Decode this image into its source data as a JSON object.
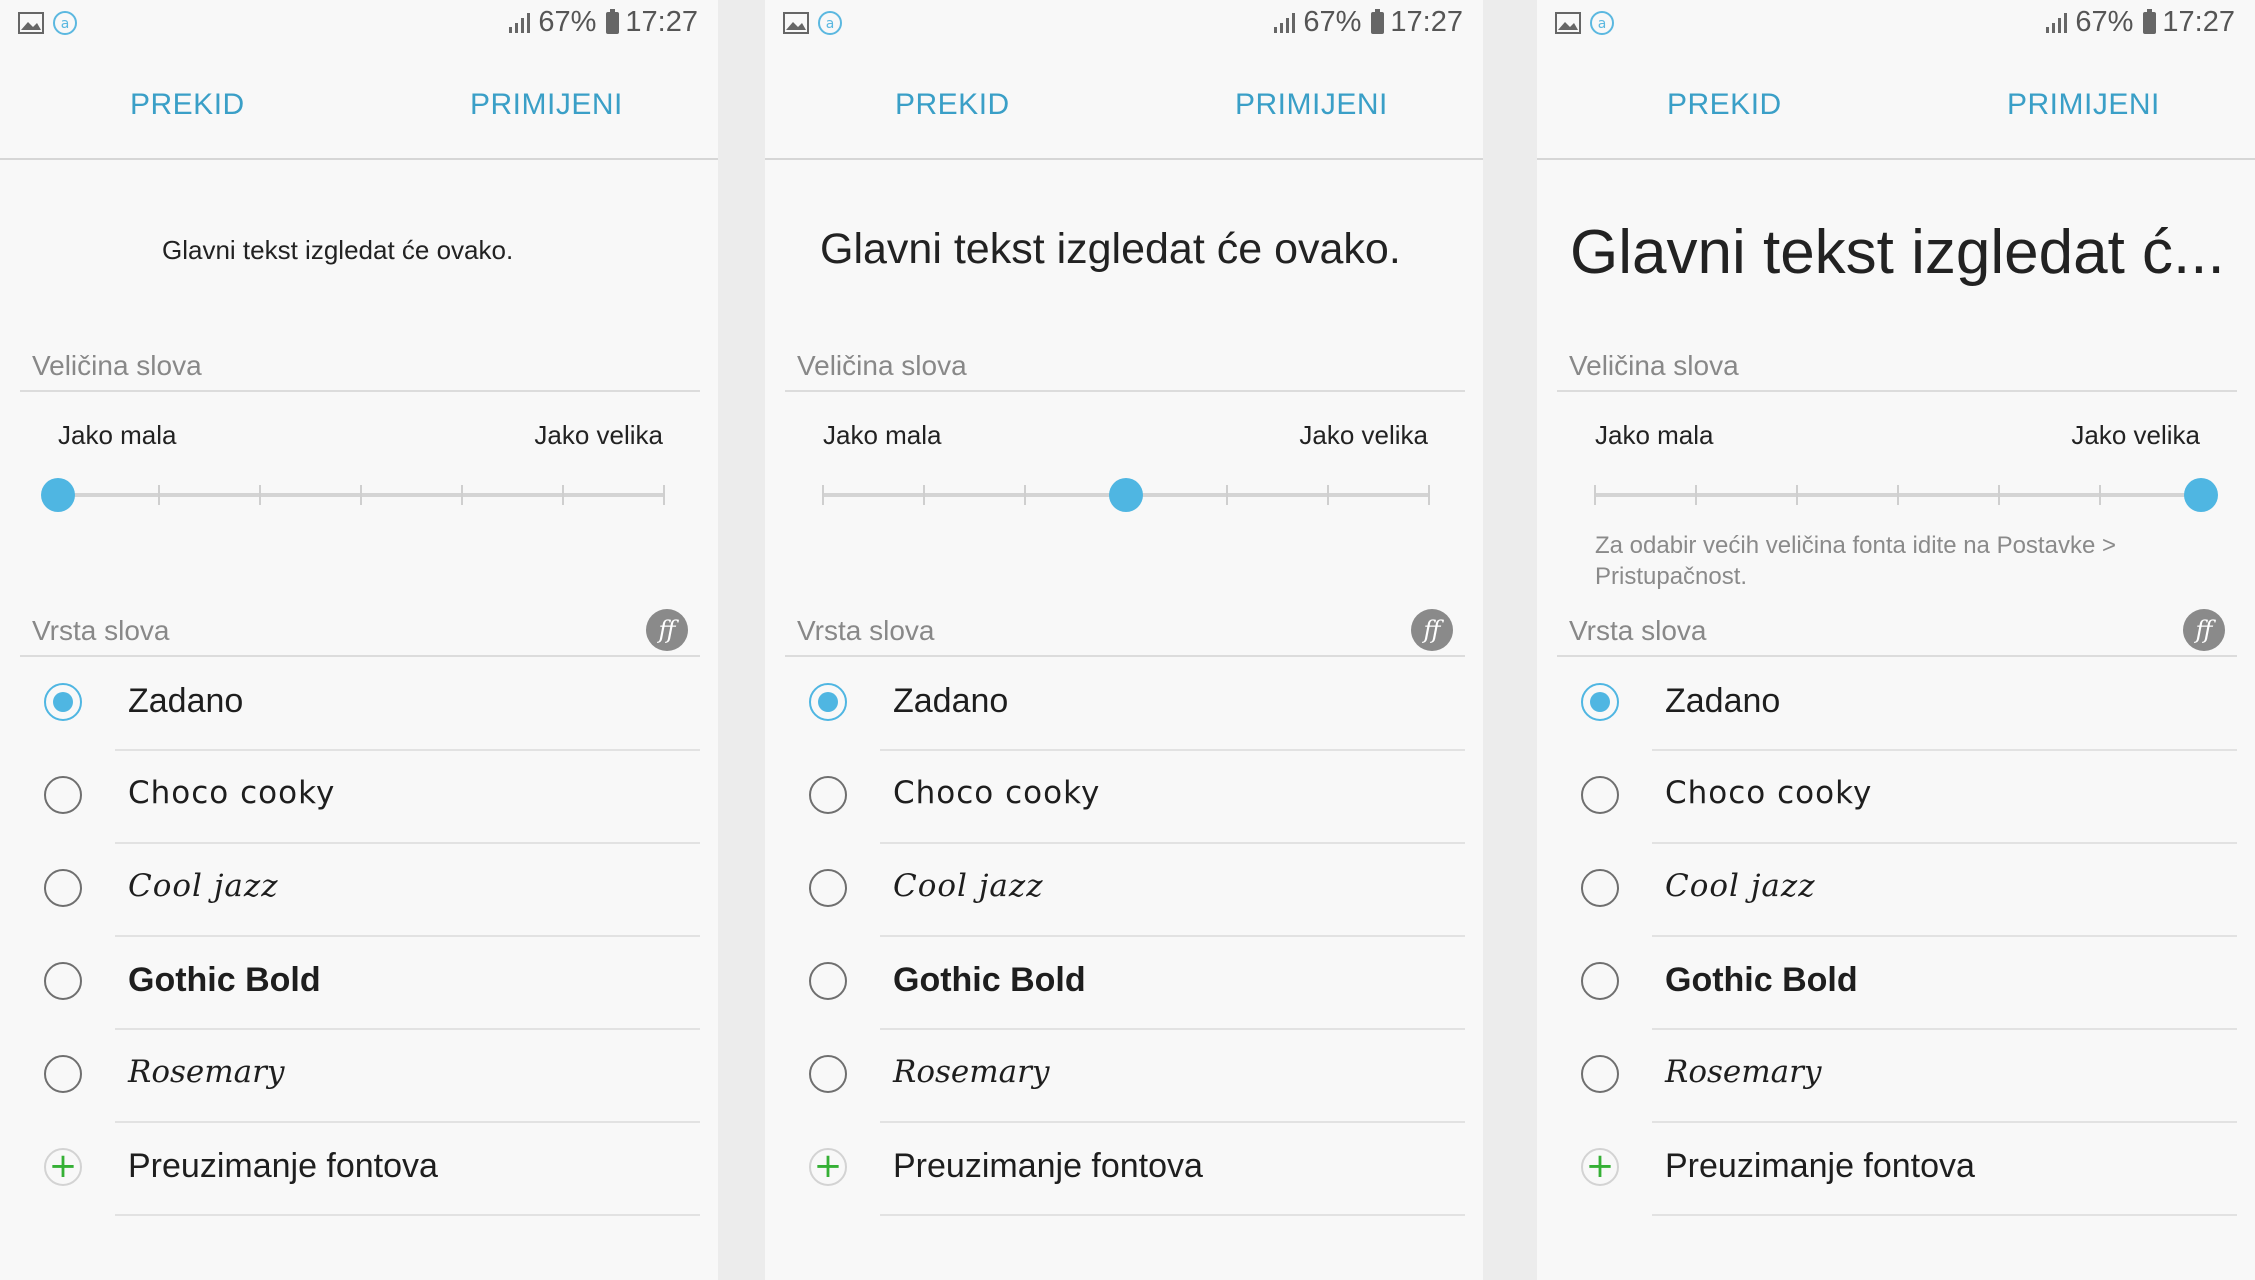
{
  "status_bar": {
    "signal": "67%",
    "time": "17:27"
  },
  "action_bar": {
    "cancel_label": "PREKID",
    "apply_label": "PRIMIJENI"
  },
  "font_size_section": {
    "title": "Veličina slova",
    "min_label": "Jako mala",
    "max_label": "Jako velika",
    "steps": 7
  },
  "font_type_section": {
    "title": "Vrsta slova",
    "items": [
      {
        "label": "Zadano",
        "selected": true
      },
      {
        "label": "Choco cooky",
        "selected": false
      },
      {
        "label": "Cool jazz",
        "selected": false
      },
      {
        "label": "Gothic Bold",
        "selected": false
      },
      {
        "label": "Rosemary",
        "selected": false
      }
    ],
    "download_label": "Preuzimanje fontova"
  },
  "screens": [
    {
      "preview_text": "Glavni tekst izgledat će ovako.",
      "slider_step": 0,
      "hint": ""
    },
    {
      "preview_text": "Glavni tekst izgledat će ovako.",
      "slider_step": 3,
      "hint": ""
    },
    {
      "preview_text": "Glavni tekst izgledat ć...",
      "slider_step": 6,
      "hint": "Za odabir većih veličina fonta idite na Postavke > Pristupačnost."
    }
  ],
  "colors": {
    "accent": "#3a9fc7",
    "slider_thumb": "#4fb6e2",
    "plus": "#35b035"
  }
}
